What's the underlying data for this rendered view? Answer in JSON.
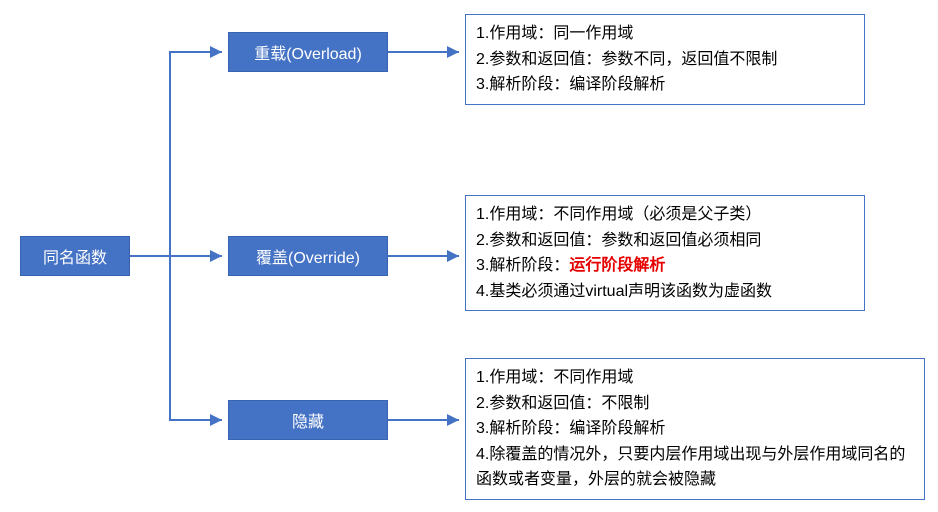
{
  "root": {
    "label": "同名函数"
  },
  "children": [
    {
      "id": "overload",
      "label": "重载(Overload)"
    },
    {
      "id": "override",
      "label": "覆盖(Override)"
    },
    {
      "id": "hide",
      "label": "隐藏"
    }
  ],
  "descriptions": {
    "overload": {
      "line1": "1.作用域：同一作用域",
      "line2": "2.参数和返回值：参数不同，返回值不限制",
      "line3": "3.解析阶段：编译阶段解析"
    },
    "override": {
      "line1": "1.作用域：不同作用域（必须是父子类）",
      "line2": "2.参数和返回值：参数和返回值必须相同",
      "line3_prefix": "3.解析阶段：",
      "line3_highlight": "运行阶段解析",
      "line4": "4.基类必须通过virtual声明该函数为虚函数"
    },
    "hide": {
      "line1": "1.作用域：不同作用域",
      "line2": "2.参数和返回值：不限制",
      "line3": "3.解析阶段：编译阶段解析",
      "line4": "4.除覆盖的情况外，只要内层作用域出现与外层作用域同名的函数或者变量，外层的就会被隐藏"
    }
  },
  "colors": {
    "box_fill": "#4472c4",
    "highlight": "#e60000"
  }
}
